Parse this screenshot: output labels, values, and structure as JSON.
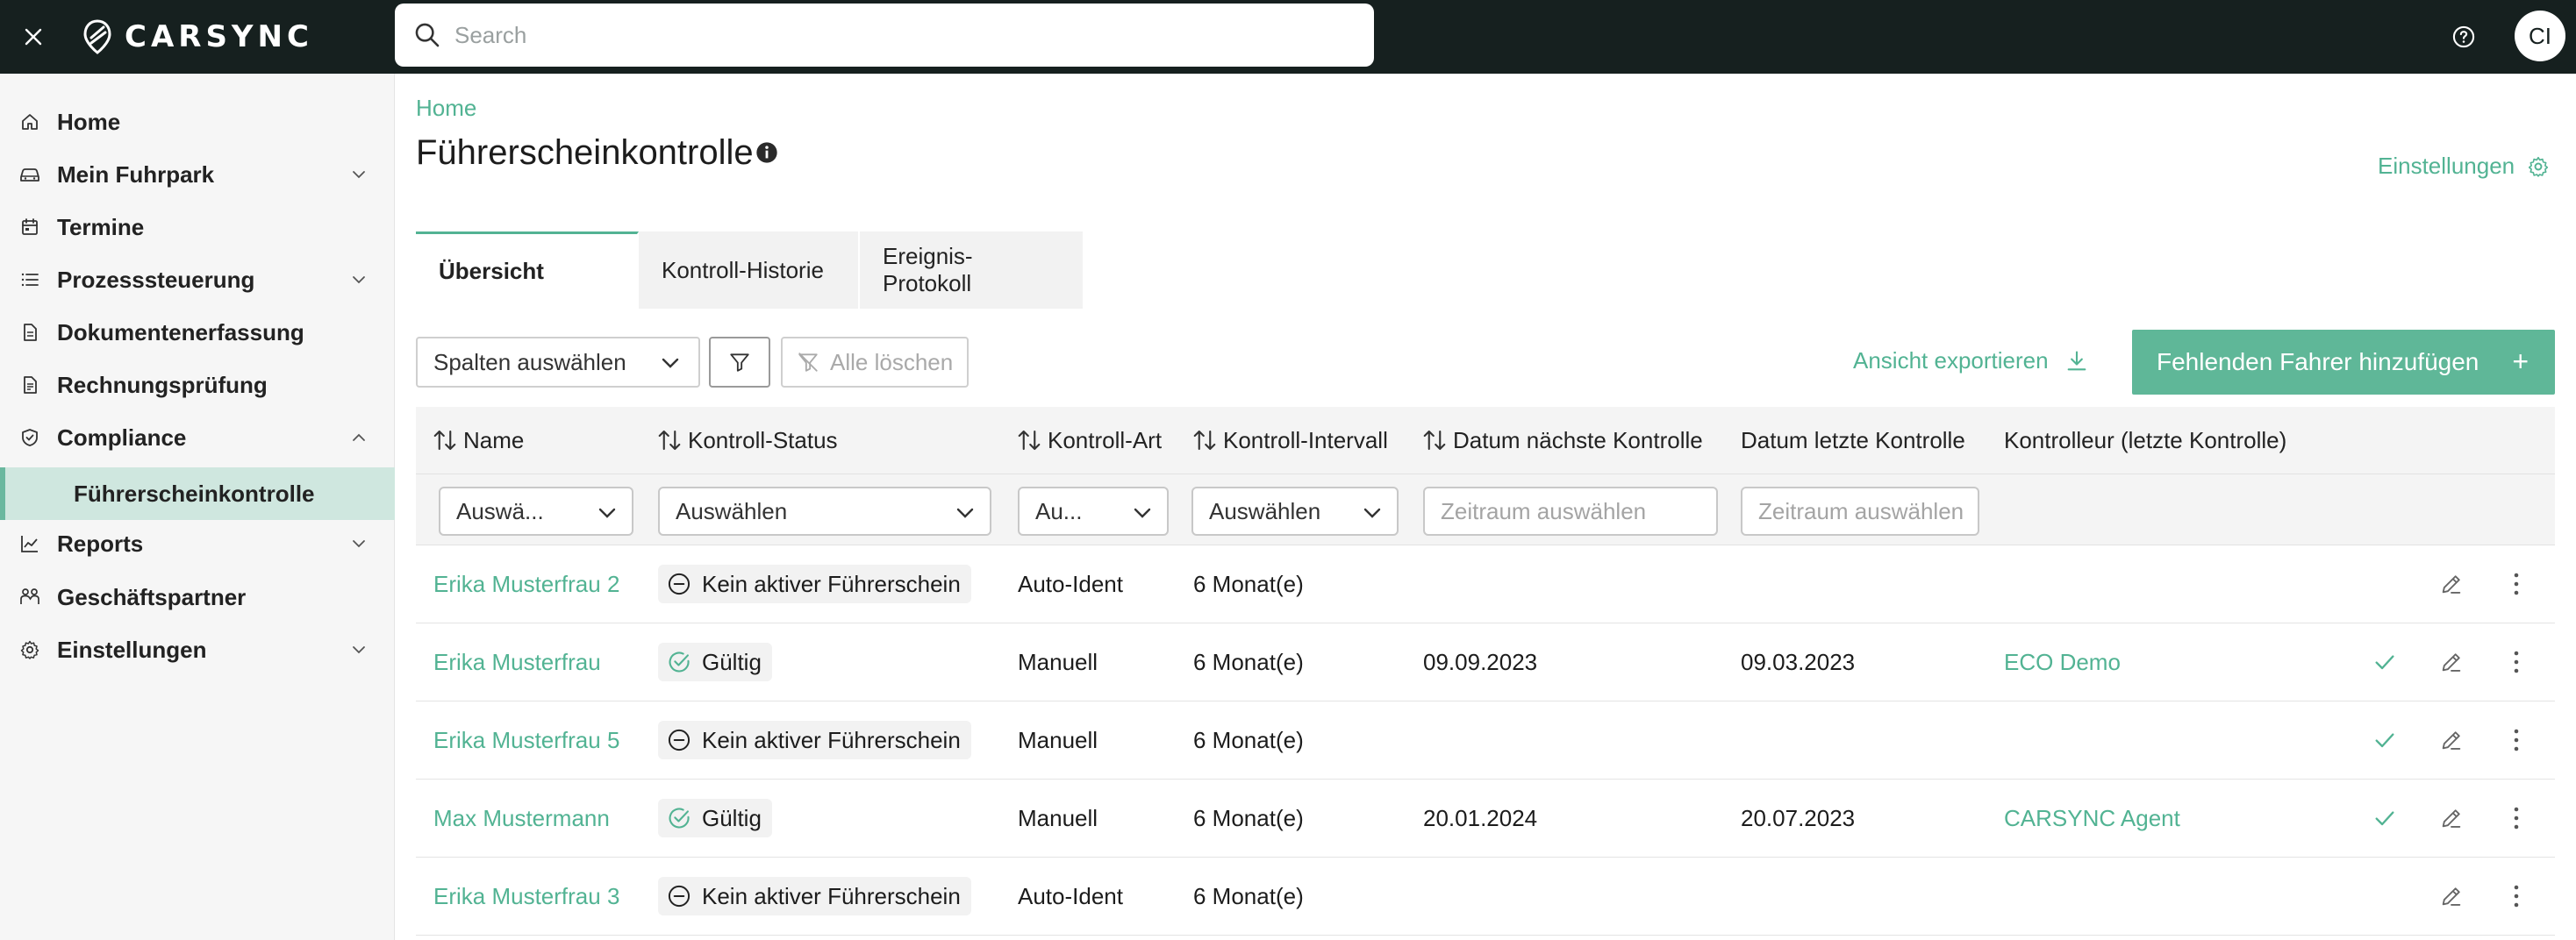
{
  "app": {
    "logo_text": "CARSYNC",
    "avatar_initials": "CI"
  },
  "search": {
    "placeholder": "Search"
  },
  "sidebar": {
    "items": [
      {
        "label": "Home",
        "icon": "home-icon"
      },
      {
        "label": "Mein Fuhrpark",
        "icon": "car-icon",
        "expandable": true
      },
      {
        "label": "Termine",
        "icon": "calendar-icon"
      },
      {
        "label": "Prozesssteuerung",
        "icon": "list-icon",
        "expandable": true
      },
      {
        "label": "Dokumentenerfassung",
        "icon": "document-icon"
      },
      {
        "label": "Rechnungsprüfung",
        "icon": "invoice-icon"
      },
      {
        "label": "Compliance",
        "icon": "shield-icon",
        "expandable": true,
        "expanded": true
      },
      {
        "label": "Führerscheinkontrolle",
        "active": true
      },
      {
        "label": "Reports",
        "icon": "chart-icon",
        "expandable": true
      },
      {
        "label": "Geschäftspartner",
        "icon": "partners-icon"
      },
      {
        "label": "Einstellungen",
        "icon": "gear-icon",
        "expandable": true
      }
    ]
  },
  "page": {
    "breadcrumb": "Home",
    "title": "Führerscheinkontrolle",
    "settings_label": "Einstellungen"
  },
  "tabs": [
    {
      "label": "Übersicht",
      "active": true
    },
    {
      "label": "Kontroll-Historie"
    },
    {
      "label": "Ereignis-Protokoll"
    }
  ],
  "toolbar": {
    "columns_select": "Spalten auswählen",
    "clear_all": "Alle löschen",
    "export_label": "Ansicht exportieren",
    "add_button": "Fehlenden Fahrer hinzufügen",
    "add_plus": "+"
  },
  "table": {
    "headers": [
      {
        "label": "Name",
        "sortable": true
      },
      {
        "label": "Kontroll-Status",
        "sortable": true
      },
      {
        "label": "Kontroll-Art",
        "sortable": true
      },
      {
        "label": "Kontroll-Intervall",
        "sortable": true
      },
      {
        "label": "Datum nächste Kontrolle",
        "sortable": true
      },
      {
        "label": "Datum letzte Kontrolle",
        "sortable": false
      },
      {
        "label": "Kontrolleur (letzte Kontrolle)",
        "sortable": false
      }
    ],
    "filters": {
      "name": "Auswä...",
      "status": "Auswählen",
      "art": "Au...",
      "interval": "Auswählen",
      "next_date_placeholder": "Zeitraum auswählen",
      "last_date_placeholder": "Zeitraum auswählen"
    },
    "rows": [
      {
        "name": "Erika Musterfrau 2",
        "status": "Kein aktiver Führerschein",
        "status_type": "inactive",
        "art": "Auto-Ident",
        "interval": "6 Monat(e)",
        "next": "",
        "last": "",
        "controller": "",
        "check": false
      },
      {
        "name": "Erika Musterfrau",
        "status": "Gültig",
        "status_type": "valid",
        "art": "Manuell",
        "interval": "6 Monat(e)",
        "next": "09.09.2023",
        "last": "09.03.2023",
        "controller": "ECO Demo",
        "check": true
      },
      {
        "name": "Erika Musterfrau 5",
        "status": "Kein aktiver Führerschein",
        "status_type": "inactive",
        "art": "Manuell",
        "interval": "6 Monat(e)",
        "next": "",
        "last": "",
        "controller": "",
        "check": true
      },
      {
        "name": "Max Mustermann",
        "status": "Gültig",
        "status_type": "valid",
        "art": "Manuell",
        "interval": "6 Monat(e)",
        "next": "20.01.2024",
        "last": "20.07.2023",
        "controller": "CARSYNC Agent",
        "check": true
      },
      {
        "name": "Erika Musterfrau 3",
        "status": "Kein aktiver Führerschein",
        "status_type": "inactive",
        "art": "Auto-Ident",
        "interval": "6 Monat(e)",
        "next": "",
        "last": "",
        "controller": "",
        "check": false
      }
    ]
  },
  "colors": {
    "accent": "#52b393",
    "topbar": "#16201f",
    "button": "#5fb798",
    "active_nav": "#cfe7df"
  }
}
